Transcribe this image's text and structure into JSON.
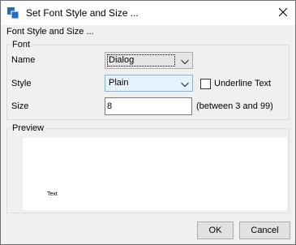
{
  "window": {
    "title": "Set Font Style and Size ..."
  },
  "dialog": {
    "section_title": "Font Style and Size ..."
  },
  "font_group": {
    "title": "Font",
    "name_label": "Name",
    "name_value": "Dialog",
    "style_label": "Style",
    "style_value": "Plain",
    "underline_label": "Underline Text",
    "underline_checked": false,
    "size_label": "Size",
    "size_value": "8",
    "size_hint": "(between 3 and 99)"
  },
  "preview_group": {
    "title": "Preview",
    "sample_text": "Text"
  },
  "buttons": {
    "ok": "OK",
    "cancel": "Cancel"
  },
  "icons": {
    "app": "font-settings-icon",
    "close": "close-icon",
    "dropdown": "chevron-down-icon"
  },
  "colors": {
    "accent": "#0078d7",
    "hover_fill": "#e5f1fb",
    "hover_border": "#7eb4ea"
  }
}
